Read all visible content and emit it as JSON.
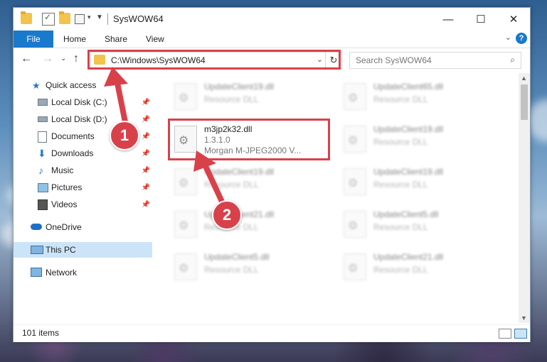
{
  "window": {
    "title": "SysWOW64"
  },
  "ribbon": {
    "tabs": [
      "File",
      "Home",
      "Share",
      "View"
    ]
  },
  "address": {
    "path": "C:\\Windows\\SysWOW64"
  },
  "search": {
    "placeholder": "Search SysWOW64"
  },
  "sidebar": {
    "items": [
      {
        "label": "Quick access",
        "icon": "star-icon"
      },
      {
        "label": "Local Disk (C:)",
        "icon": "drive-icon",
        "pinned": true
      },
      {
        "label": "Local Disk (D:)",
        "icon": "drive-icon",
        "pinned": true
      },
      {
        "label": "Documents",
        "icon": "documents-icon",
        "pinned": true
      },
      {
        "label": "Downloads",
        "icon": "download-icon",
        "pinned": true
      },
      {
        "label": "Music",
        "icon": "music-icon",
        "pinned": true
      },
      {
        "label": "Pictures",
        "icon": "pictures-icon",
        "pinned": true
      },
      {
        "label": "Videos",
        "icon": "videos-icon",
        "pinned": true
      },
      {
        "label": "OneDrive",
        "icon": "cloud-icon"
      },
      {
        "label": "This PC",
        "icon": "computer-icon",
        "selected": true
      },
      {
        "label": "Network",
        "icon": "network-icon"
      }
    ]
  },
  "files": {
    "left": [
      {
        "name": "UpdateClient19.dll",
        "type": "Resource DLL"
      },
      {
        "name": "m3jp2k32.dll",
        "version": "1.3.1.0",
        "company": "Morgan M-JPEG2000 V..."
      },
      {
        "name": "UpdateClient19.dll",
        "type": "Resource DLL"
      },
      {
        "name": "UpdateClient21.dll",
        "type": "Resource DLL"
      },
      {
        "name": "UpdateClient5.dll",
        "type": "Resource DLL"
      }
    ],
    "right": [
      {
        "name": "UpdateClient65.dll",
        "type": "Resource DLL"
      },
      {
        "name": "UpdateClient19.dll",
        "type": "Resource DLL"
      },
      {
        "name": "UpdateClient19.dll",
        "type": "Resource DLL"
      },
      {
        "name": "UpdateClient5.dll",
        "type": "Resource DLL"
      },
      {
        "name": "UpdateClient21.dll",
        "type": "Resource DLL"
      }
    ]
  },
  "status": {
    "item_count": "101 items"
  },
  "callouts": {
    "one": "1",
    "two": "2"
  },
  "colors": {
    "accent": "#1979ca",
    "highlight": "#d9414a",
    "selected": "#cce4f7"
  }
}
